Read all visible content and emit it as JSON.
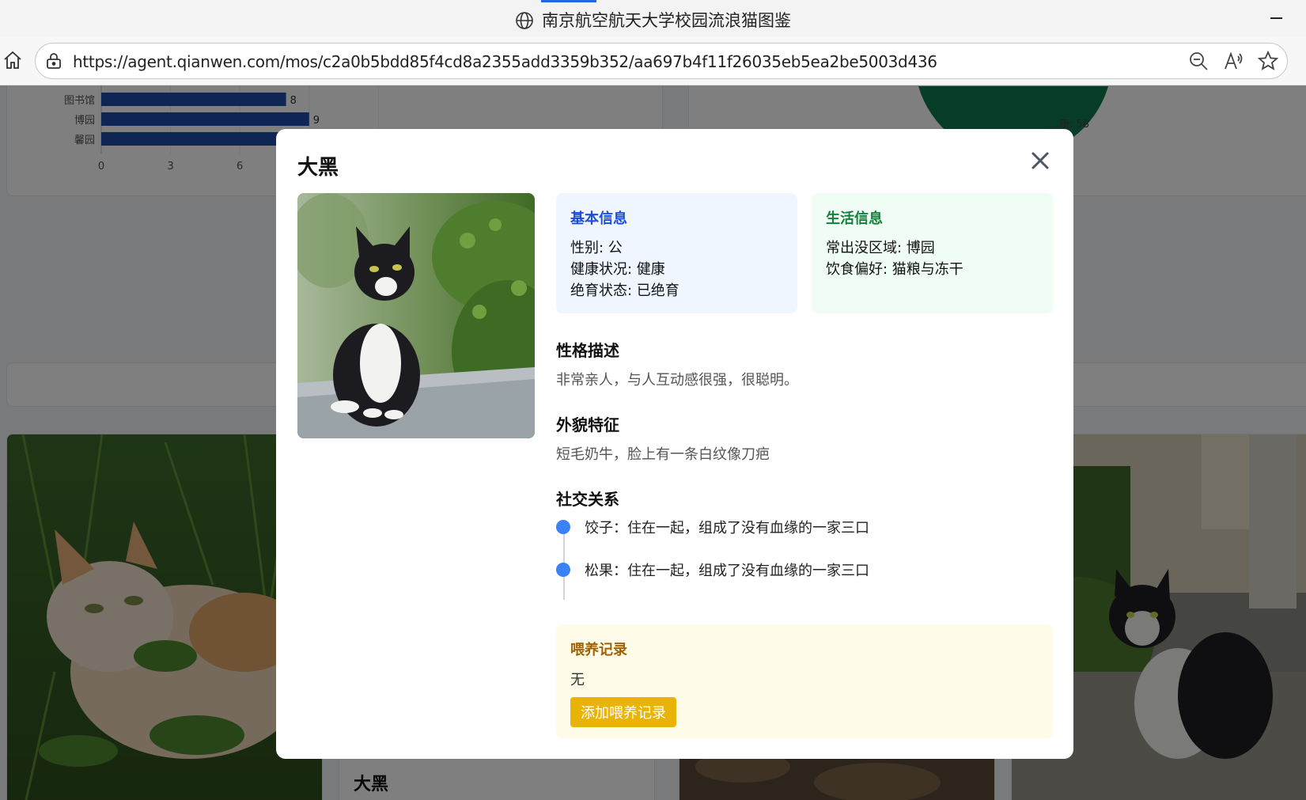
{
  "browser": {
    "tab_title": "南京航空航天大学校园流浪猫图鉴",
    "url": "https://agent.qianwen.com/mos/c2a0b5bdd85f4cd8a2355add3359b352/aa697b4f11f26035eb5ea2be5003d436"
  },
  "background": {
    "chart_data": {
      "type": "bar",
      "orientation": "horizontal",
      "categories": [
        "图书馆",
        "博园",
        "馨园"
      ],
      "values": [
        8,
        9,
        null
      ],
      "x_ticks": [
        "0",
        "3",
        "6"
      ]
    },
    "donut_label": "…康: 58",
    "card_name": "大黑"
  },
  "modal": {
    "title": "大黑",
    "basic_info": {
      "heading": "基本信息",
      "rows": [
        "性别: 公",
        "健康状况: 健康",
        "绝育状态: 已绝育"
      ]
    },
    "life_info": {
      "heading": "生活信息",
      "rows": [
        "常出没区域: 博园",
        "饮食偏好: 猫粮与冻干"
      ]
    },
    "personality": {
      "heading": "性格描述",
      "text": "非常亲人，与人互动感很强，很聪明。"
    },
    "appearance": {
      "heading": "外貌特征",
      "text": "短毛奶牛，脸上有一条白纹像刀疤"
    },
    "social": {
      "heading": "社交关系",
      "items": [
        "饺子：住在一起，组成了没有血缘的一家三口",
        "松果：住在一起，组成了没有血缘的一家三口"
      ]
    },
    "feeding": {
      "heading": "喂养记录",
      "empty_text": "无",
      "add_button": "添加喂养记录"
    }
  },
  "colors": {
    "accent_blue": "#3b82f6",
    "basic_bg": "#eff6ff",
    "life_bg": "#f0fdf4",
    "feed_bg": "#fefce8",
    "feed_button": "#eab308",
    "bar_color": "#1e4aa8",
    "donut_green": "#0f7a4e"
  }
}
